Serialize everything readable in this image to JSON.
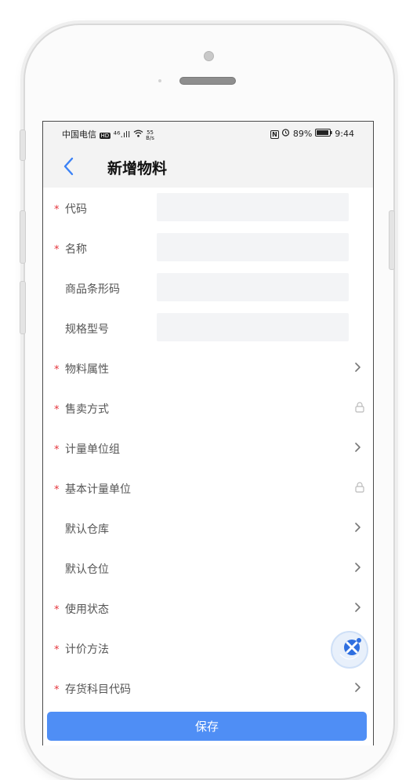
{
  "status_bar": {
    "carrier": "中国电信",
    "hd_badge": "HD",
    "network": "⁴⁶.ıll",
    "speed_value": "55",
    "speed_unit": "B/s",
    "nfc": "N",
    "battery_percent": "89%",
    "time": "9:44"
  },
  "header": {
    "title": "新增物料"
  },
  "form": {
    "fields": [
      {
        "label": "代码",
        "required": true,
        "type": "input"
      },
      {
        "label": "名称",
        "required": true,
        "type": "input"
      },
      {
        "label": "商品条形码",
        "required": false,
        "type": "input"
      },
      {
        "label": "规格型号",
        "required": false,
        "type": "input"
      },
      {
        "label": "物料属性",
        "required": true,
        "type": "select"
      },
      {
        "label": "售卖方式",
        "required": true,
        "type": "locked"
      },
      {
        "label": "计量单位组",
        "required": true,
        "type": "select"
      },
      {
        "label": "基本计量单位",
        "required": true,
        "type": "locked"
      },
      {
        "label": "默认仓库",
        "required": false,
        "type": "select"
      },
      {
        "label": "默认仓位",
        "required": false,
        "type": "select"
      },
      {
        "label": "使用状态",
        "required": true,
        "type": "select"
      },
      {
        "label": "计价方法",
        "required": true,
        "type": "select"
      },
      {
        "label": "存货科目代码",
        "required": true,
        "type": "select"
      }
    ],
    "required_mark": "*"
  },
  "actions": {
    "save_label": "保存"
  },
  "colors": {
    "accent": "#4f8ef5",
    "required": "#e5333b",
    "input_bg": "#f3f4f6"
  }
}
